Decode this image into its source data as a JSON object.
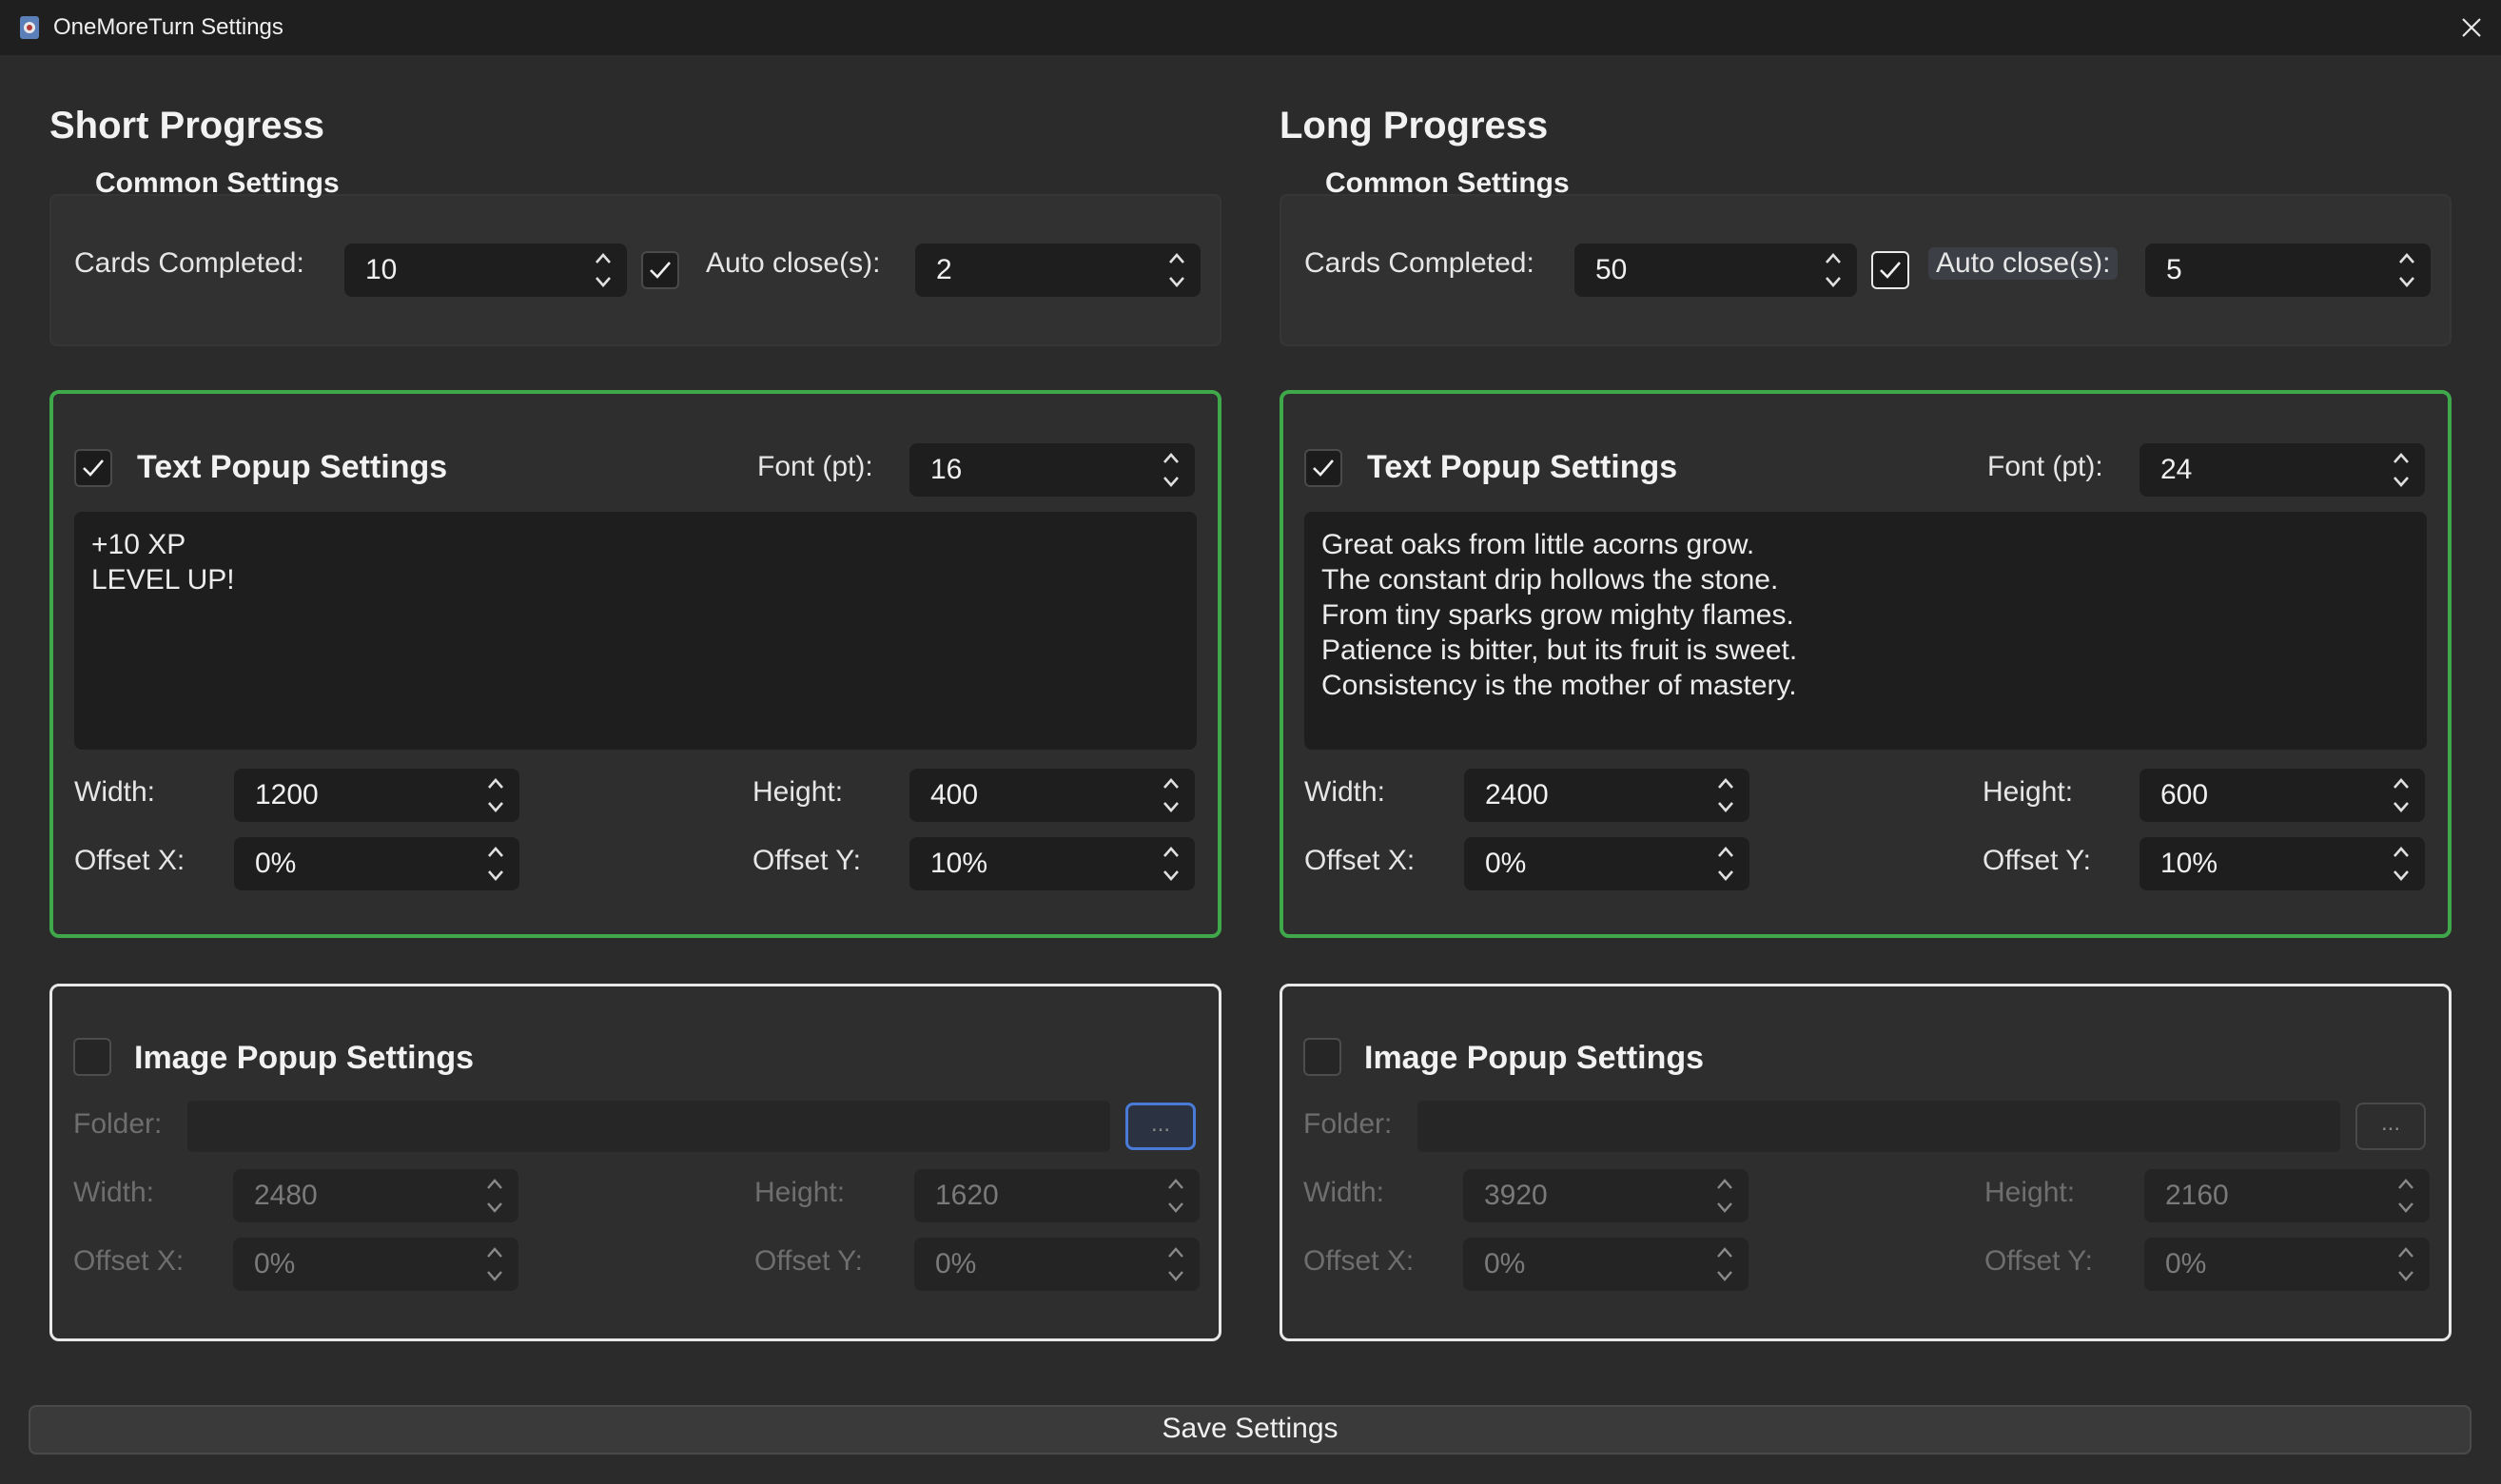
{
  "window": {
    "title": "OneMoreTurn Settings"
  },
  "columns": [
    {
      "title": "Short Progress",
      "common": {
        "caption": "Common Settings",
        "cards_label": "Cards Completed:",
        "cards_value": "10",
        "auto_close_checked": true,
        "auto_close_label": "Auto close(s):",
        "auto_close_value": "2"
      },
      "text_popup": {
        "enabled": true,
        "header": "Text Popup Settings",
        "font_label": "Font (pt):",
        "font_value": "16",
        "text": "+10 XP\nLEVEL UP!",
        "width_label": "Width:",
        "width_value": "1200",
        "height_label": "Height:",
        "height_value": "400",
        "offset_x_label": "Offset X:",
        "offset_x_value": "0%",
        "offset_y_label": "Offset Y:",
        "offset_y_value": "10%"
      },
      "image_popup": {
        "enabled": false,
        "header": "Image Popup Settings",
        "folder_label": "Folder:",
        "folder_value": "",
        "browse_label": "...",
        "width_label": "Width:",
        "width_value": "2480",
        "height_label": "Height:",
        "height_value": "1620",
        "offset_x_label": "Offset X:",
        "offset_x_value": "0%",
        "offset_y_label": "Offset Y:",
        "offset_y_value": "0%"
      }
    },
    {
      "title": "Long Progress",
      "common": {
        "caption": "Common Settings",
        "cards_label": "Cards Completed:",
        "cards_value": "50",
        "auto_close_checked": true,
        "auto_close_label": "Auto close(s):",
        "auto_close_value": "5"
      },
      "text_popup": {
        "enabled": true,
        "header": "Text Popup Settings",
        "font_label": "Font (pt):",
        "font_value": "24",
        "text": "Great oaks from little acorns grow.\nThe constant drip hollows the stone.\nFrom tiny sparks grow mighty flames.\nPatience is bitter, but its fruit is sweet.\nConsistency is the mother of mastery.",
        "width_label": "Width:",
        "width_value": "2400",
        "height_label": "Height:",
        "height_value": "600",
        "offset_x_label": "Offset X:",
        "offset_x_value": "0%",
        "offset_y_label": "Offset Y:",
        "offset_y_value": "10%"
      },
      "image_popup": {
        "enabled": false,
        "header": "Image Popup Settings",
        "folder_label": "Folder:",
        "folder_value": "",
        "browse_label": "...",
        "width_label": "Width:",
        "width_value": "3920",
        "height_label": "Height:",
        "height_value": "2160",
        "offset_x_label": "Offset X:",
        "offset_x_value": "0%",
        "offset_y_label": "Offset Y:",
        "offset_y_value": "0%"
      }
    }
  ],
  "save_label": "Save Settings",
  "colors": {
    "accent_green": "#3ea84a",
    "focus_blue": "#4a7bd8",
    "background": "#2b2b2b"
  }
}
